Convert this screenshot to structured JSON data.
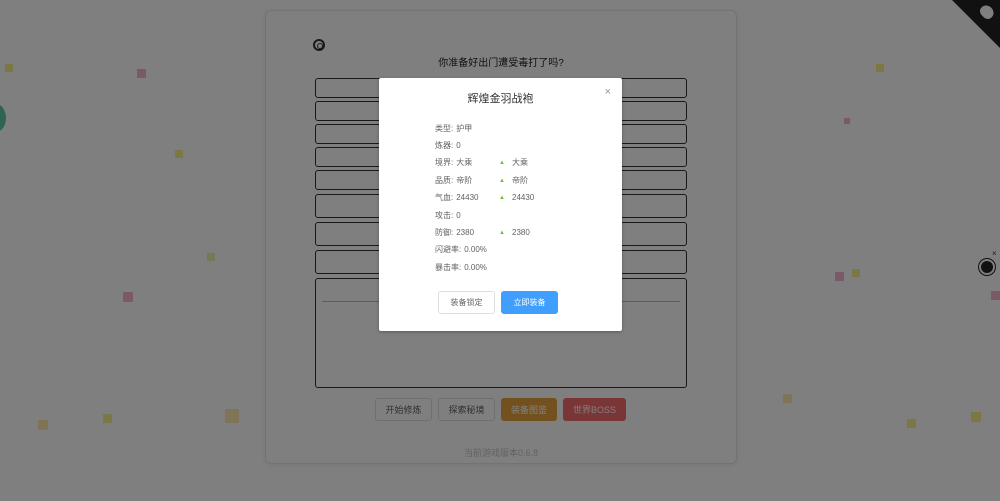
{
  "page": {
    "question": "你准备好出门遭受毒打了吗?",
    "version": "当前游戏版本0.6.8",
    "actions": [
      {
        "label": "开始修炼",
        "style": "plain"
      },
      {
        "label": "探索秘境",
        "style": "plain"
      },
      {
        "label": "装备图鉴",
        "style": "warning"
      },
      {
        "label": "世界BOSS",
        "style": "danger"
      }
    ]
  },
  "dialog": {
    "title": "辉煌金羽战袍",
    "close": "×",
    "stats": [
      {
        "label": "类型:",
        "value": "护甲",
        "compare": ""
      },
      {
        "label": "炼器:",
        "value": "0",
        "compare": ""
      },
      {
        "label": "境界:",
        "value": "大乘",
        "compare": "大乘"
      },
      {
        "label": "品质:",
        "value": "帝阶",
        "compare": "帝阶"
      },
      {
        "label": "气血:",
        "value": "24430",
        "compare": "24430"
      },
      {
        "label": "攻击:",
        "value": "0",
        "compare": ""
      },
      {
        "label": "防御:",
        "value": "2380",
        "compare": "2380"
      },
      {
        "label": "闪避率:",
        "value": "0.00%",
        "compare": ""
      },
      {
        "label": "暴击率:",
        "value": "0.00%",
        "compare": ""
      }
    ],
    "buttons": {
      "lock": "装备锁定",
      "equip": "立即装备"
    }
  },
  "side_widget": {
    "close": "×"
  },
  "colors": {
    "primary": "#409eff",
    "warning": "#e6a23c",
    "danger": "#f56c6c",
    "up_arrow": "#67c23a"
  }
}
